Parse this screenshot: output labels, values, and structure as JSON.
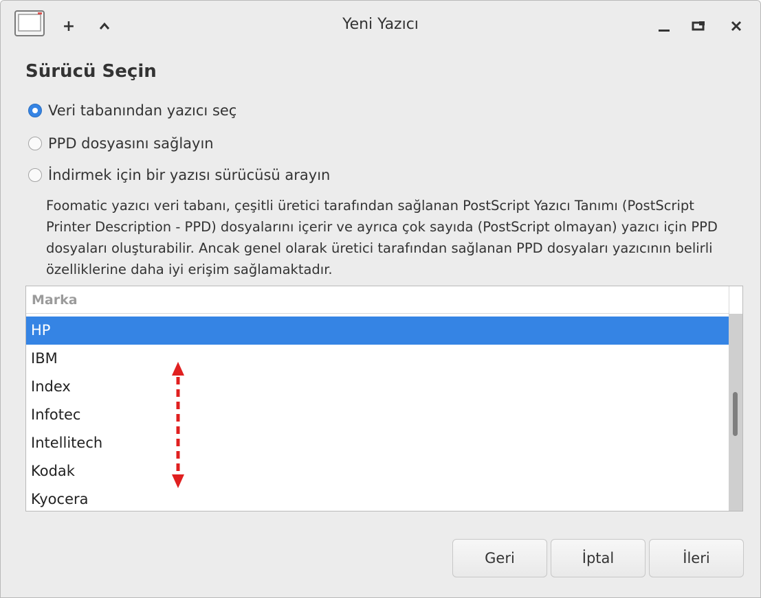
{
  "window": {
    "title": "Yeni Yazıcı",
    "add_symbol": "+",
    "up_symbol": "^",
    "minimize_symbol": "_",
    "maximize_symbol": "❐",
    "close_symbol": "✕"
  },
  "heading": "Sürücü Seçin",
  "options": [
    {
      "label": "Veri tabanından yazıcı seç",
      "checked": true
    },
    {
      "label": "PPD dosyasını sağlayın",
      "checked": false
    },
    {
      "label": "İndirmek için bir yazısı sürücüsü arayın",
      "checked": false
    }
  ],
  "description": "Foomatic yazıcı veri tabanı, çeşitli üretici tarafından sağlanan PostScript Yazıcı Tanımı (PostScript Printer Description - PPD) dosyalarını içerir ve ayrıca çok sayıda (PostScript olmayan) yazıcı için PPD dosyaları oluşturabilir. Ancak genel olarak üretici tarafından sağlanan PPD dosyaları yazıcının belirli özelliklerine daha iyi erişim sağlamaktadır.",
  "list": {
    "header": "Marka",
    "items": [
      "HP",
      "IBM",
      "Index",
      "Infotec",
      "Intellitech",
      "Kodak",
      "Kyocera"
    ],
    "selected_index": 0
  },
  "buttons": {
    "back": "Geri",
    "cancel": "İptal",
    "next": "İleri"
  },
  "colors": {
    "accent": "#3584e4",
    "annotation_arrow": "#e02020"
  },
  "icons": {
    "app": "printer-window-icon",
    "annotation": "double-headed-arrow"
  }
}
